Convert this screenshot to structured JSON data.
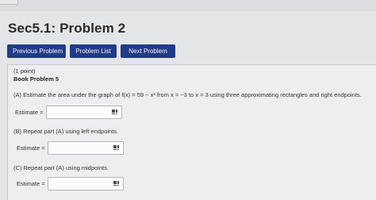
{
  "page": {
    "title": "Sec5.1: Problem 2"
  },
  "nav": {
    "previous_label": "Previous Problem",
    "list_label": "Problem List",
    "next_label": "Next Problem",
    "button_color": "#223b86"
  },
  "problem": {
    "points": "(1 point)",
    "book_problem": "Book Problem 5",
    "part_a": "(A) Estimate the area under the graph of f(x) = 59 − x² from x = −3 to x = 3 using three approximating rectangles and right endpoints.",
    "part_b": "(B) Repeat part (A) using left endpoints.",
    "part_c": "(C) Repeat part (A) using midpoints.",
    "estimate_label": "Estimate =",
    "estimate_a_value": "",
    "estimate_b_value": "",
    "estimate_c_value": "",
    "input_icon": "grid-keypad-icon"
  }
}
